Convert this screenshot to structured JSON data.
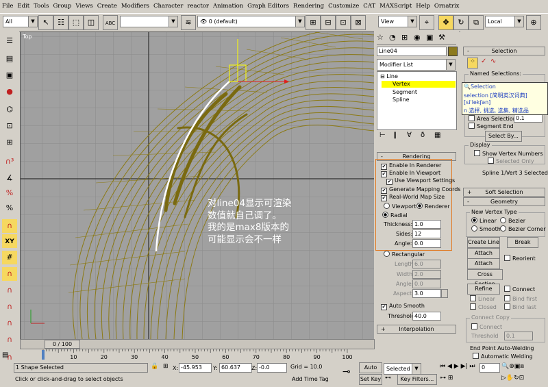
{
  "menu": [
    "File",
    "Edit",
    "Tools",
    "Group",
    "Views",
    "Create",
    "Modifiers",
    "Character",
    "reactor",
    "Animation",
    "Graph Editors",
    "Rendering",
    "Customize",
    "CAT",
    "MAXScript",
    "Help",
    "Ornatrix"
  ],
  "toolbar": {
    "selection_filter": "All",
    "named_sel_field": "",
    "layer_combo": "0 (default)",
    "view_combo": "View",
    "coord_combo": "Local"
  },
  "viewport": {
    "label": "Top",
    "note_lines": [
      "对line04显示可渲染",
      "数值就自己调了。",
      "我的是max8版本的",
      "可能显示会不一样"
    ]
  },
  "command_panel": {
    "object_name": "Line04",
    "object_color": "#8c7a1e",
    "modifier_list_label": "Modifier List",
    "stack": [
      "Line",
      "Vertex",
      "Segment",
      "Spline"
    ],
    "rendering": {
      "title": "Rendering",
      "enable_in_renderer": "Enable In Renderer",
      "enable_in_viewport": "Enable In Viewport",
      "use_viewport_settings": "Use Viewport Settings",
      "generate_mapping": "Generate Mapping Coords.",
      "real_world_map": "Real-World Map Size",
      "viewport": "Viewport",
      "renderer": "Renderer",
      "radial": "Radial",
      "thickness_label": "Thickness:",
      "thickness": "1.0",
      "sides_label": "Sides:",
      "sides": "12",
      "angle_label": "Angle:",
      "angle": "0.0",
      "rectangular": "Rectangular",
      "length_label": "Length:",
      "length": "6.0",
      "width_label": "Width:",
      "width": "2.0",
      "rangle_label": "Angle:",
      "rangle": "0.0",
      "aspect_label": "Aspect:",
      "aspect": "3.0",
      "auto_smooth": "Auto Smooth",
      "threshold_label": "Threshold:",
      "threshold": "40.0"
    },
    "interpolation": "Interpolation"
  },
  "right_panel": {
    "selection_title": "Selection",
    "named_selections": "Named Selections:",
    "area_selection": "Area Selection:",
    "area_value": "0.1",
    "segment_end": "Segment End",
    "select_by": "Select By...",
    "display": "Display",
    "show_vertex_numbers": "Show Vertex Numbers",
    "selected_only": "Selected Only",
    "sel_status": "Spline 1/Vert 3 Selected",
    "soft_selection": "Soft Selection",
    "geometry": "Geometry",
    "new_vertex_type": "New Vertex Type",
    "linear": "Linear",
    "bezier": "Bezier",
    "smooth": "Smooth",
    "bezier_corner": "Bezier Corner",
    "create_line": "Create Line",
    "break": "Break",
    "attach": "Attach",
    "reorient": "Reorient",
    "attach_mult": "Attach Mult.",
    "cross_section": "Cross Section",
    "refine": "Refine",
    "connect": "Connect",
    "r_linear": "Linear",
    "bind_first": "Bind first",
    "closed": "Closed",
    "bind_last": "Bind last",
    "connect_copy": "Connect Copy",
    "cc_connect": "Connect",
    "cc_threshold": "Threshold",
    "cc_threshold_value": "0.1",
    "end_point": "End Point Auto-Welding",
    "auto_welding": "Automatic Welding"
  },
  "tooltip": {
    "line1": "Selection",
    "line2": "selection [简明英汉词典]",
    "line3": "[si'lekʃən]",
    "line4": "n.选择, 挑选, 选集, 精选品"
  },
  "timeline": {
    "slider": "0 / 100",
    "ticks": [
      "0",
      "10",
      "20",
      "30",
      "40",
      "50",
      "60",
      "70",
      "80",
      "90",
      "100"
    ]
  },
  "status": {
    "selected": "1 Shape Selected",
    "prompt": "Click or click-and-drag to select objects",
    "x_label": "X:",
    "x": "-45.953",
    "y_label": "Y:",
    "y": "60.637",
    "z_label": "Z:",
    "z": "-0.0",
    "grid": "Grid = 10.0",
    "add_time_tag": "Add Time Tag",
    "auto_key": "Auto Key",
    "set_key": "Set Key",
    "key_mode": "Selected",
    "key_filters": "Key Filters...",
    "frame": "0"
  },
  "colors": {
    "wire": "#8c7a14",
    "select": "#ffff00",
    "orange": "#e07820"
  }
}
